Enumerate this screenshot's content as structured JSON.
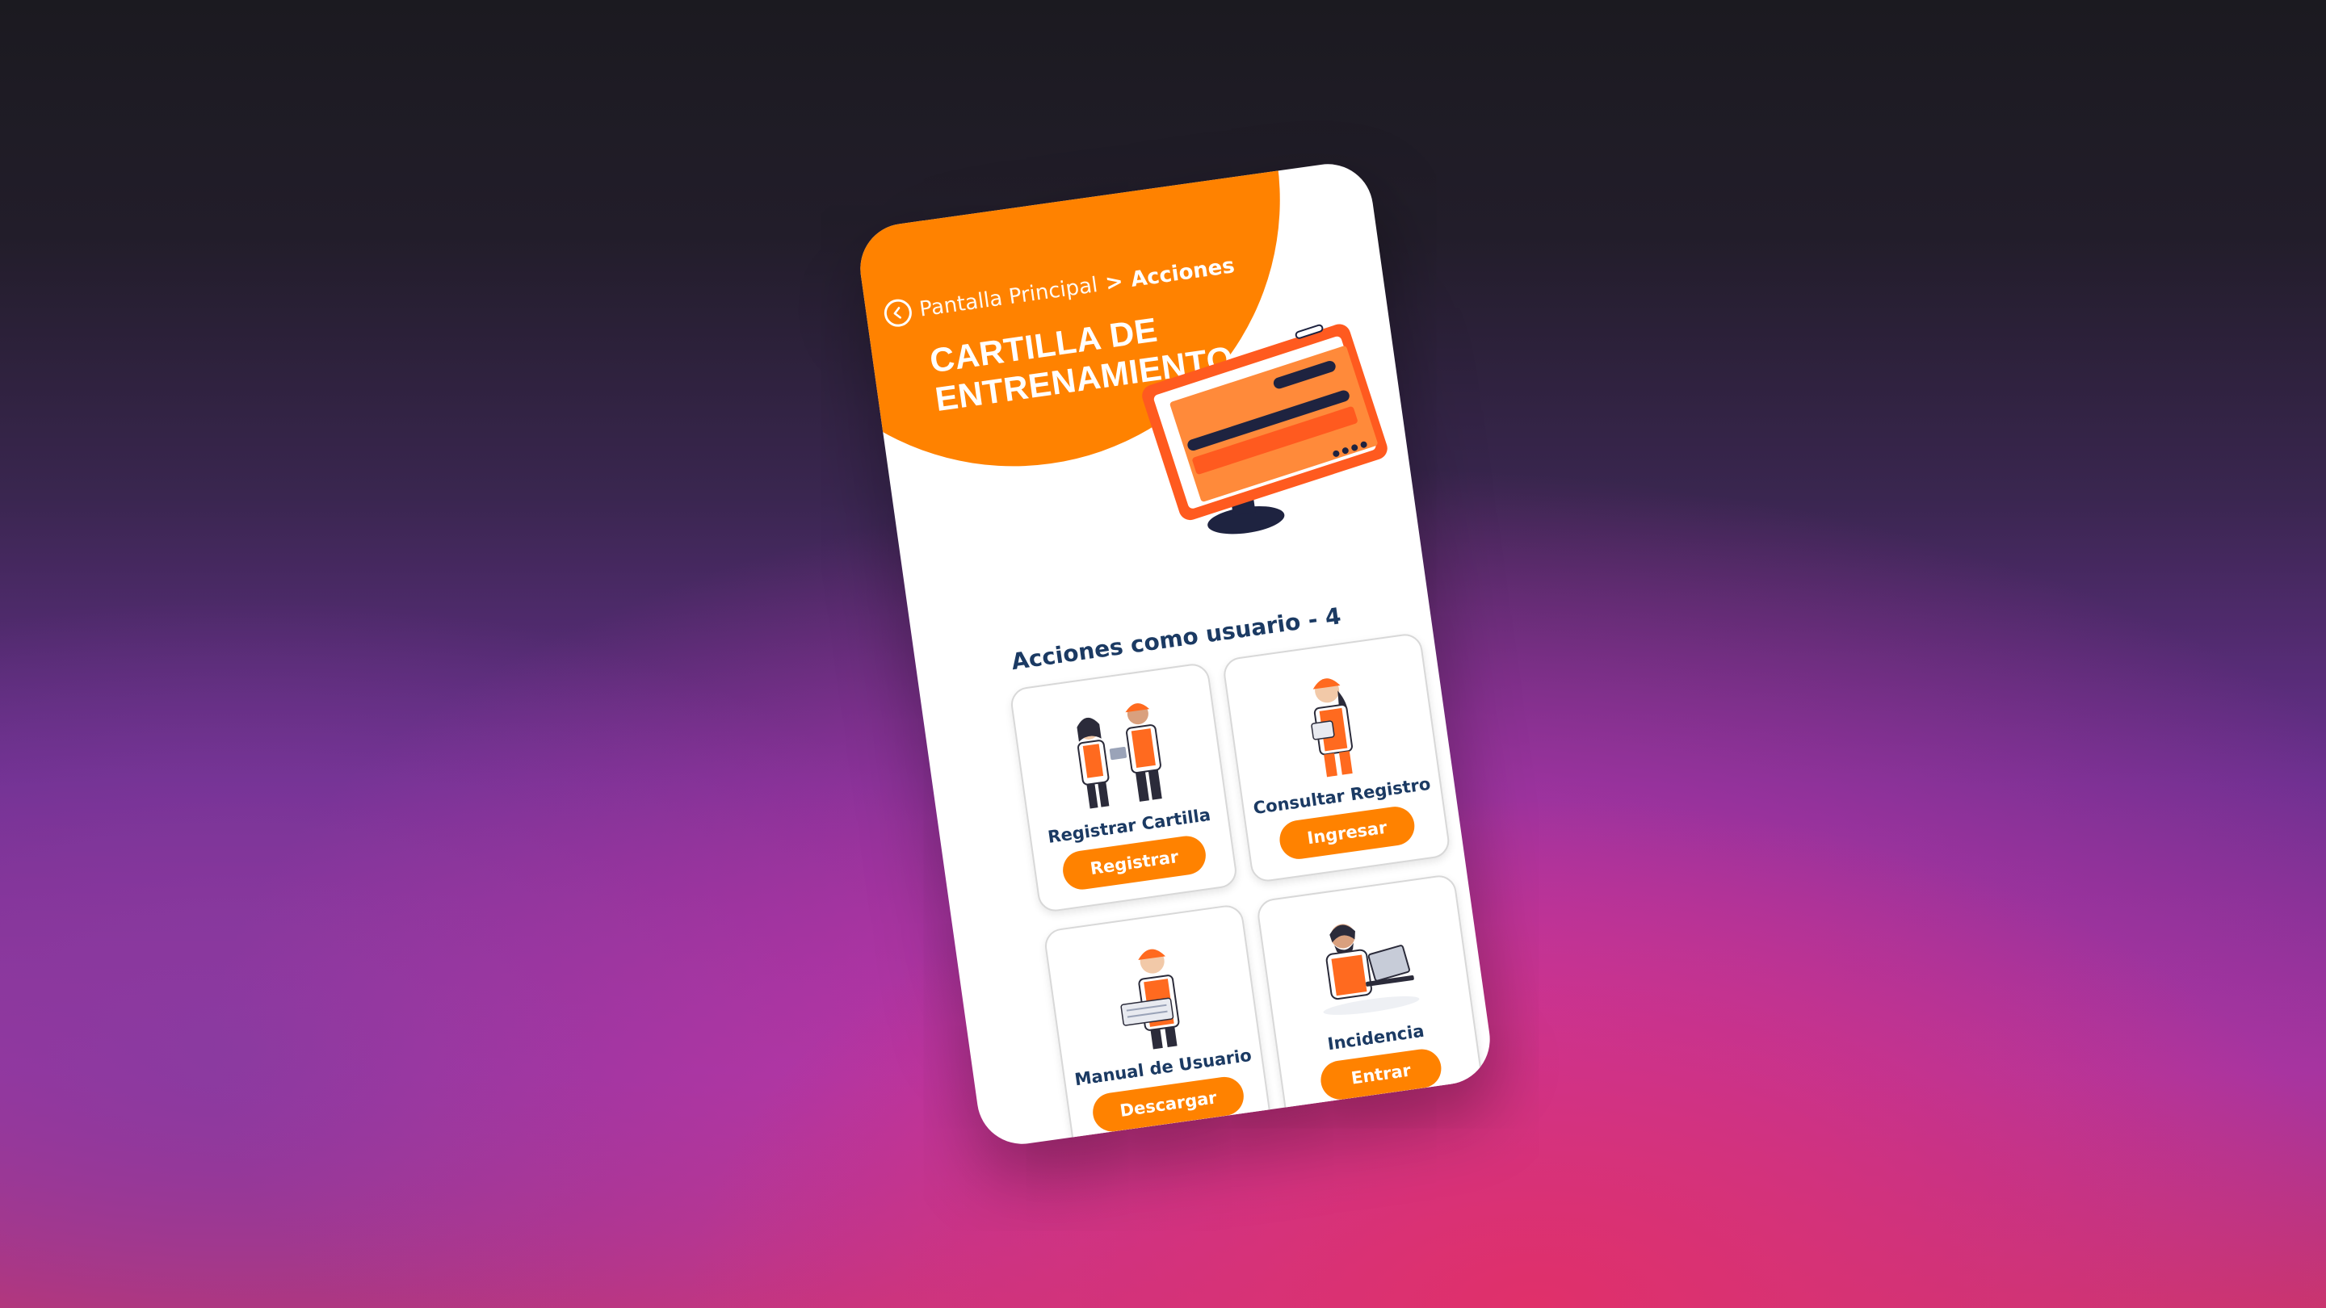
{
  "colors": {
    "accent": "#ff8200",
    "navy": "#1b3a63",
    "card_border": "#d8d8d8"
  },
  "breadcrumb": {
    "back_icon": "chevron-left-icon",
    "home": "Pantalla Principal",
    "separator": ">",
    "current": "Acciones"
  },
  "header": {
    "title_line1": "CARTILLA DE",
    "title_line2": "ENTRENAMIENTO"
  },
  "section": {
    "title": "Acciones como usuario - 4"
  },
  "cards": [
    {
      "label": "Registrar Cartilla",
      "button": "Registrar",
      "illustration": "two-workers-icon"
    },
    {
      "label": "Consultar Registro",
      "button": "Ingresar",
      "illustration": "worker-clipboard-icon"
    },
    {
      "label": "Manual de Usuario",
      "button": "Descargar",
      "illustration": "worker-manual-icon"
    },
    {
      "label": "Incidencia",
      "button": "Entrar",
      "illustration": "worker-laptop-icon"
    }
  ]
}
